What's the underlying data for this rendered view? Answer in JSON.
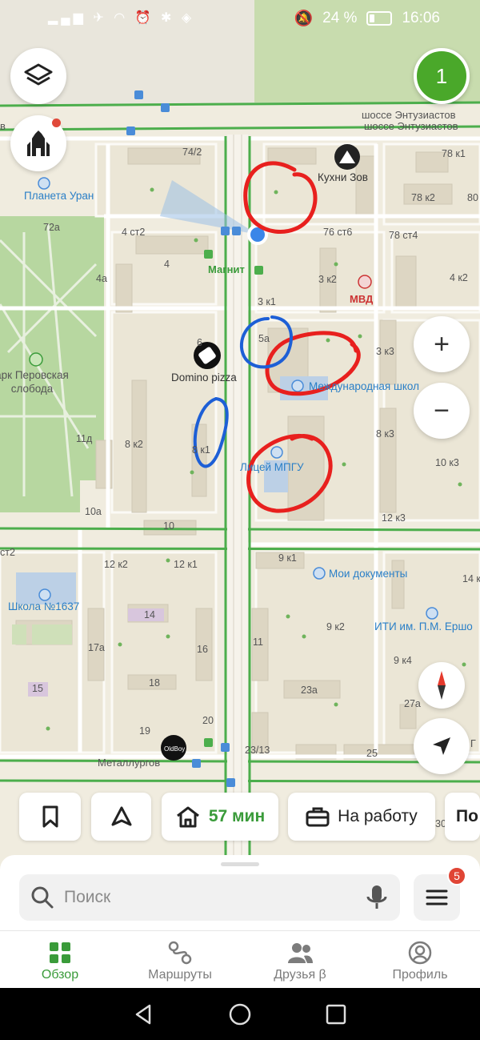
{
  "status_bar": {
    "battery": "24 %",
    "time": "16:06"
  },
  "map": {
    "streets": [
      "шоссе Энтузиастов",
      "шоссе Энтузиастов",
      "Металлургов"
    ],
    "park": "арк Перовская слобода",
    "pois": {
      "planeta": "Планета Уран",
      "kuhni": "Кухни Зов",
      "magnit": "Магнит",
      "mvd": "МВД",
      "domino": "Domino pizza",
      "mezhd": "Международная школ",
      "licey": "Лицей МПГУ",
      "docs": "Мои документы",
      "shkola": "Школа №1637",
      "iti": "ИТИ им. П.М. Ершо"
    },
    "buildings": [
      "74/2",
      "78 к1",
      "78 к2",
      "80",
      "72а",
      "4 ст2",
      "76 ст6",
      "78 ст4",
      "4",
      "4а",
      "3 к2",
      "4 к2",
      "3 к1",
      "5а",
      "6",
      "3 к3",
      "11д",
      "8 к2",
      "8 к1",
      "8 к3",
      "10 к3",
      "10а",
      "10",
      "12 к3",
      "ст2",
      "12 к2",
      "12 к1",
      "9 к1",
      "14 к",
      "14",
      "17а",
      "16",
      "11",
      "9 к2",
      "9 к4",
      "15",
      "18",
      "23а",
      "27а",
      "19",
      "20",
      "23/13",
      "25",
      "30",
      "Г"
    ]
  },
  "controls": {
    "routes_count": "1",
    "zoom_in": "+",
    "zoom_out": "−"
  },
  "chips": {
    "home_time": "57 мин",
    "work": "На работу",
    "partial": "По"
  },
  "sheet": {
    "search_placeholder": "Поиск",
    "menu_badge": "5",
    "tabs": [
      "Обзор",
      "Маршруты",
      "Друзья β",
      "Профиль"
    ]
  },
  "colors": {
    "accent": "#3a9b3a",
    "road_green": "#4cae4c",
    "annotation_red": "#e8201e",
    "annotation_blue": "#1d5fd6"
  }
}
